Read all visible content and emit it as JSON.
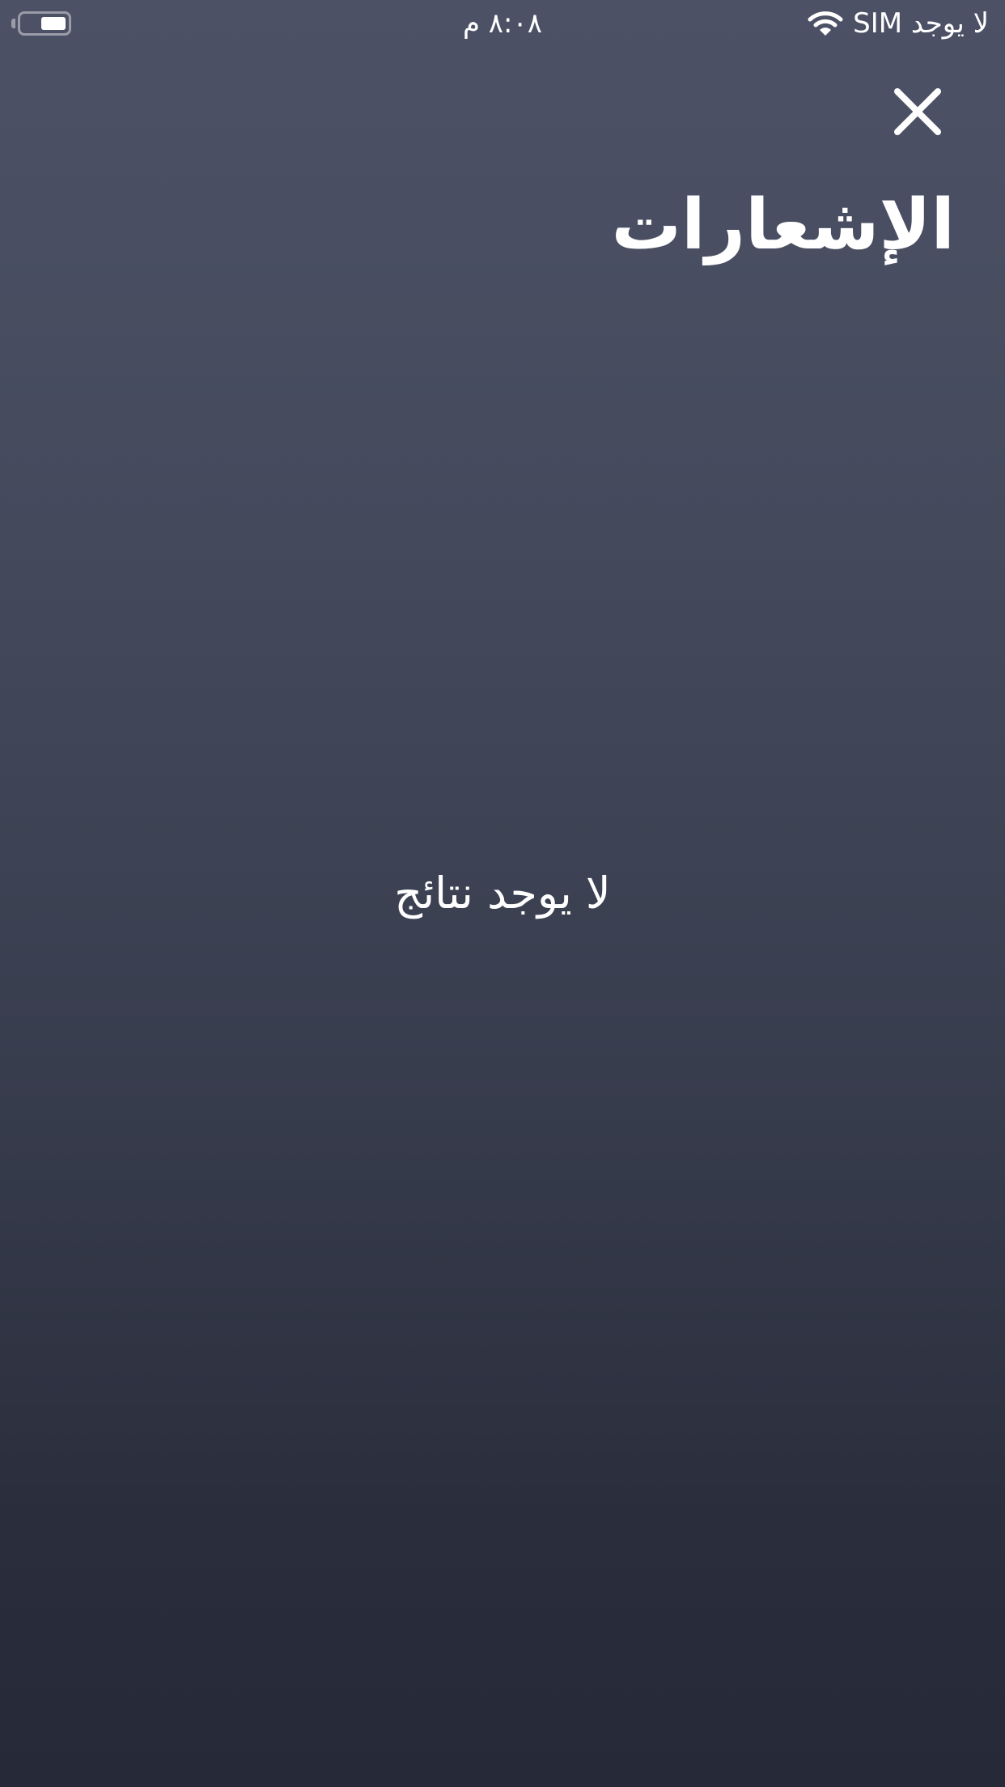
{
  "status_bar": {
    "carrier": "لا يوجد SIM",
    "time": "٨:٠٨ م",
    "icons": {
      "wifi": "wifi-icon",
      "battery": "battery-icon"
    }
  },
  "header": {
    "close_icon": "close-icon",
    "title": "الإشعارات"
  },
  "main": {
    "empty_message": "لا يوجد نتائج"
  },
  "colors": {
    "background_top": "#4d5166",
    "background_bottom": "#262a38",
    "text": "#ffffff"
  }
}
